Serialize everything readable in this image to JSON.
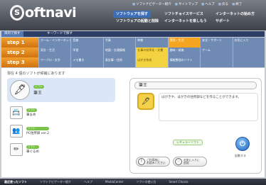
{
  "header": {
    "logo_mark": "s",
    "logo_text": "oftnavi",
    "topnav": [
      "ソフトナビゲーター紹介",
      "サイトマップ",
      "ヘルプ",
      "戻る",
      "終了"
    ],
    "nav": {
      "software_search": "ソフトウェアを探す",
      "software_choice": "ソフトチョイスサービス",
      "internet_start": "インターネットの始め方",
      "software_setup": "ソフトウェアの起動と削除",
      "internet_enjoy": "インターネットを楽しもう",
      "support": "サポート"
    }
  },
  "search_tabs": [
    "目的で探す",
    "キーワードで探す"
  ],
  "steps": [
    {
      "label": "step 1",
      "cells": [
        "ホーム・インターネット",
        "音楽",
        "写真",
        "映像",
        "実用・生活",
        "安全・サポート",
        "お気に入り"
      ]
    },
    {
      "label": "step 2",
      "cells": [
        "家計・生活",
        "学習",
        "地図・交通情報",
        "仕事の効率化・文書",
        "趣味・娯楽",
        "ゲーム",
        ""
      ]
    },
    {
      "label": "step 3",
      "cells": [
        "ワープロ・文字",
        "メモ書き",
        "表計算・住所",
        "はがき作成",
        "情報整理のソフト",
        "",
        ""
      ]
    }
  ],
  "main": {
    "count_text": "現在 4 個のソフトが候補にあります",
    "items": [
      {
        "badge": "ソフト",
        "name": "筆王",
        "icon": "fude-icon"
      },
      {
        "badge": "ソフト",
        "name": "筆まめ",
        "icon": "fudemame-icon"
      },
      {
        "badge": "ソフト",
        "name": "PC住所録 ver.2",
        "icon": "address-icon"
      },
      {
        "badge": "ソフト",
        "name": "筆ぐるめ",
        "icon": "fudegurume-icon"
      }
    ],
    "detail": {
      "title": "筆王",
      "description": "はがきや、はがきの住所録などを作ることができます。",
      "tag": "レギュラーソフト",
      "launch_label": "起動する",
      "launch_symbol": "⏻",
      "pill1": "ご利用前に\nお読みください",
      "pill2": "お気に入りに\n追加"
    }
  },
  "footer": {
    "items": [
      "最近使ったソフト",
      "ソフトナビゲーター紹介",
      "ヘルプ",
      "MediaCenter",
      "ソフトの使い方",
      "Smart Choice"
    ]
  }
}
